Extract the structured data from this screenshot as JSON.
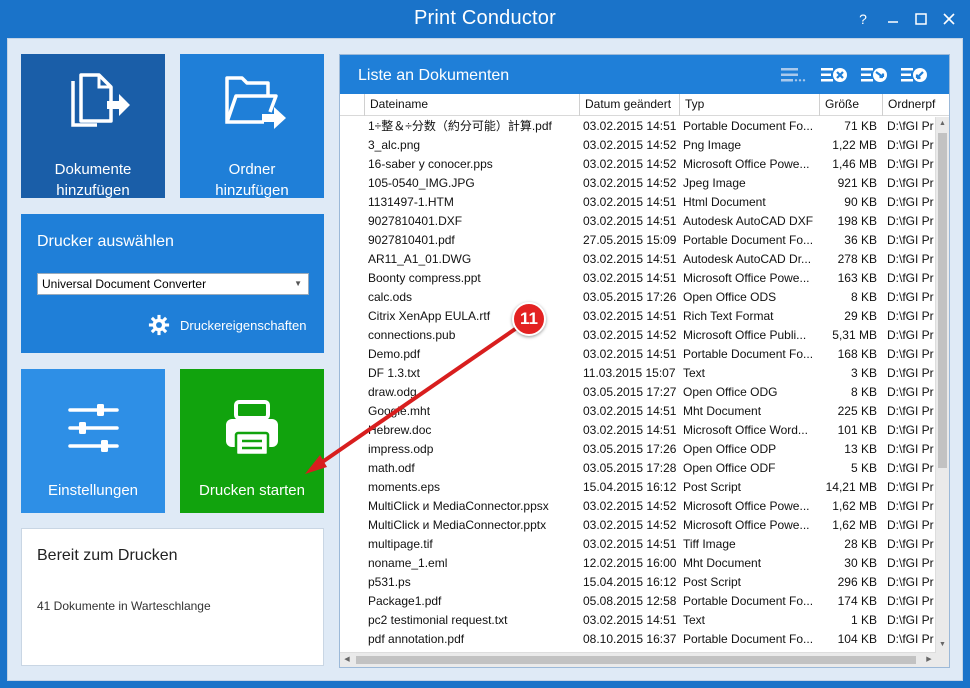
{
  "window": {
    "title": "Print Conductor",
    "help_label": "?",
    "minimize_label": "—",
    "maximize_label": "☐",
    "close_label": "✕"
  },
  "tiles": {
    "add_documents": {
      "line1": "Dokumente",
      "line2": "hinzufügen",
      "icon": "add-documents-icon"
    },
    "add_folder": {
      "line1": "Ordner",
      "line2": "hinzufügen",
      "icon": "add-folder-icon"
    },
    "settings": {
      "label": "Einstellungen",
      "icon": "sliders-icon"
    },
    "start_print": {
      "label": "Drucken starten",
      "icon": "printer-icon"
    }
  },
  "printer": {
    "title": "Drucker auswählen",
    "selected": "Universal Document Converter",
    "properties_label": "Druckereigenschaften"
  },
  "status": {
    "title": "Bereit zum Drucken",
    "queue": "41 Dokumente in Warteschlange"
  },
  "list": {
    "title": "Liste an Dokumenten",
    "columns": [
      "Dateiname",
      "Datum geändert",
      "Typ",
      "Größe",
      "Ordnerpf"
    ],
    "rows": [
      [
        "1÷整＆÷分数（約分可能）計算.pdf",
        "03.02.2015 14:51",
        "Portable Document Fo...",
        "71 KB",
        "D:\\fGI Pr"
      ],
      [
        "3_alc.png",
        "03.02.2015 14:52",
        "Png Image",
        "1,22 MB",
        "D:\\fGI Pr"
      ],
      [
        "16-saber y conocer.pps",
        "03.02.2015 14:52",
        "Microsoft Office Powe...",
        "1,46 MB",
        "D:\\fGI Pr"
      ],
      [
        "105-0540_IMG.JPG",
        "03.02.2015 14:52",
        "Jpeg Image",
        "921 KB",
        "D:\\fGI Pr"
      ],
      [
        "1131497-1.HTM",
        "03.02.2015 14:51",
        "Html Document",
        "90 KB",
        "D:\\fGI Pr"
      ],
      [
        "9027810401.DXF",
        "03.02.2015 14:51",
        "Autodesk AutoCAD DXF",
        "198 KB",
        "D:\\fGI Pr"
      ],
      [
        "9027810401.pdf",
        "27.05.2015 15:09",
        "Portable Document Fo...",
        "36 KB",
        "D:\\fGI Pr"
      ],
      [
        "AR11_A1_01.DWG",
        "03.02.2015 14:51",
        "Autodesk AutoCAD Dr...",
        "278 KB",
        "D:\\fGI Pr"
      ],
      [
        "Boonty compress.ppt",
        "03.02.2015 14:51",
        "Microsoft Office Powe...",
        "163 KB",
        "D:\\fGI Pr"
      ],
      [
        "calc.ods",
        "03.05.2015 17:26",
        "Open Office ODS",
        "8 KB",
        "D:\\fGI Pr"
      ],
      [
        "Citrix XenApp EULA.rtf",
        "03.02.2015 14:51",
        "Rich Text Format",
        "29 KB",
        "D:\\fGI Pr"
      ],
      [
        "connections.pub",
        "03.02.2015 14:52",
        "Microsoft Office Publi...",
        "5,31 MB",
        "D:\\fGI Pr"
      ],
      [
        "Demo.pdf",
        "03.02.2015 14:51",
        "Portable Document Fo...",
        "168 KB",
        "D:\\fGI Pr"
      ],
      [
        "DF 1.3.txt",
        "11.03.2015 15:07",
        "Text",
        "3 KB",
        "D:\\fGI Pr"
      ],
      [
        "draw.odg",
        "03.05.2015 17:27",
        "Open Office ODG",
        "8 KB",
        "D:\\fGI Pr"
      ],
      [
        "Google.mht",
        "03.02.2015 14:51",
        "Mht Document",
        "225 KB",
        "D:\\fGI Pr"
      ],
      [
        "Hebrew.doc",
        "03.02.2015 14:51",
        "Microsoft Office Word...",
        "101 KB",
        "D:\\fGI Pr"
      ],
      [
        "impress.odp",
        "03.05.2015 17:26",
        "Open Office ODP",
        "13 KB",
        "D:\\fGI Pr"
      ],
      [
        "math.odf",
        "03.05.2015 17:28",
        "Open Office ODF",
        "5 KB",
        "D:\\fGI Pr"
      ],
      [
        "moments.eps",
        "15.04.2015 16:12",
        "Post Script",
        "14,21 MB",
        "D:\\fGI Pr"
      ],
      [
        "MultiClick и MediaConnector.ppsx",
        "03.02.2015 14:52",
        "Microsoft Office Powe...",
        "1,62 MB",
        "D:\\fGI Pr"
      ],
      [
        "MultiClick и MediaConnector.pptx",
        "03.02.2015 14:52",
        "Microsoft Office Powe...",
        "1,62 MB",
        "D:\\fGI Pr"
      ],
      [
        "multipage.tif",
        "03.02.2015 14:51",
        "Tiff Image",
        "28 KB",
        "D:\\fGI Pr"
      ],
      [
        "noname_1.eml",
        "12.02.2015 16:00",
        "Mht Document",
        "30 KB",
        "D:\\fGI Pr"
      ],
      [
        "p531.ps",
        "15.04.2015 16:12",
        "Post Script",
        "296 KB",
        "D:\\fGI Pr"
      ],
      [
        "Package1.pdf",
        "05.08.2015 12:58",
        "Portable Document Fo...",
        "174 KB",
        "D:\\fGI Pr"
      ],
      [
        "pc2 testimonial request.txt",
        "03.02.2015 14:51",
        "Text",
        "1 KB",
        "D:\\fGI Pr"
      ],
      [
        "pdf annotation.pdf",
        "08.10.2015 16:37",
        "Portable Document Fo...",
        "104 KB",
        "D:\\fGI Pr"
      ]
    ]
  },
  "annotation": {
    "badge": "11",
    "color": "#e32222"
  },
  "colors": {
    "accent": "#1f7fd8",
    "dark_tile": "#1a5ea8",
    "green_tile": "#11a30d",
    "background": "#dfeaf6"
  }
}
